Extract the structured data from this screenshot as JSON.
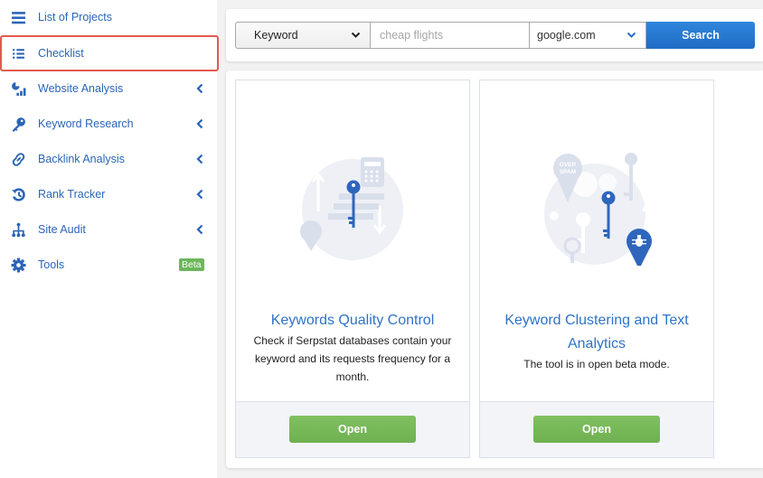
{
  "sidebar": {
    "items": [
      {
        "label": "List of Projects",
        "icon": "hamburger-icon",
        "has_submenu": false
      },
      {
        "label": "Checklist",
        "icon": "checklist-icon",
        "has_submenu": false,
        "active": true
      },
      {
        "label": "Website Analysis",
        "icon": "analytics-icon",
        "has_submenu": true
      },
      {
        "label": "Keyword Research",
        "icon": "key-icon",
        "has_submenu": true
      },
      {
        "label": "Backlink Analysis",
        "icon": "link-icon",
        "has_submenu": true
      },
      {
        "label": "Rank Tracker",
        "icon": "history-icon",
        "has_submenu": true
      },
      {
        "label": "Site Audit",
        "icon": "sitemap-icon",
        "has_submenu": true
      },
      {
        "label": "Tools",
        "icon": "gear-icon",
        "has_submenu": false,
        "badge": "Beta"
      }
    ]
  },
  "search": {
    "type_selected": "Keyword",
    "query_placeholder": "cheap flights",
    "query_value": "",
    "database_selected": "google.com",
    "button_label": "Search"
  },
  "cards": [
    {
      "title": "Keywords Quality Control",
      "description": "Check if Serpstat databases contain your keyword and its requests frequency for a month.",
      "button_label": "Open"
    },
    {
      "title": "Keyword Clustering and Text Analytics",
      "description": "The tool is in open beta mode.",
      "button_label": "Open",
      "illustration_text": "OVER SPAM"
    }
  ],
  "colors": {
    "accent_blue": "#2a65b8",
    "search_button": "#2277cf",
    "open_button": "#76b75a",
    "active_border": "#e25a4f",
    "beta_badge": "#6db65b"
  }
}
